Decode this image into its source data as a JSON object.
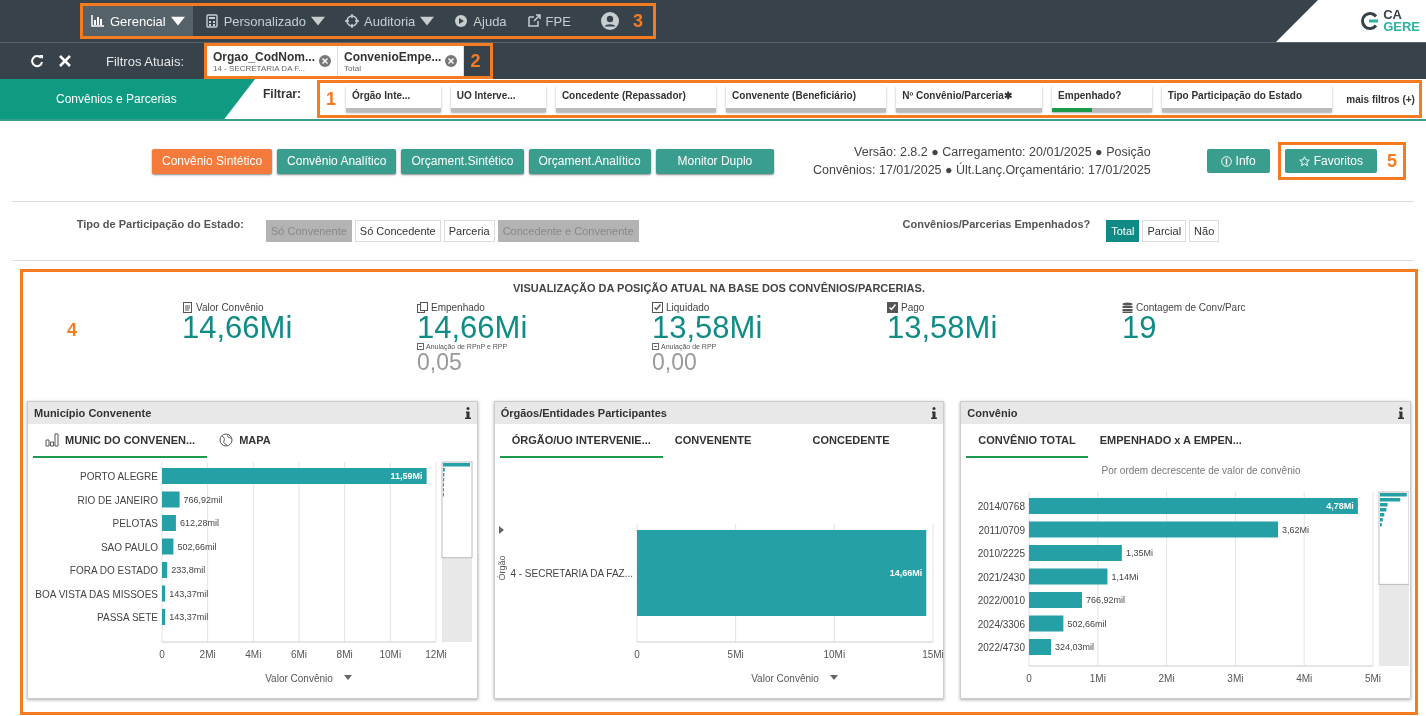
{
  "nav": {
    "callout": "3",
    "items": [
      {
        "label": "Gerencial",
        "kind": "menu",
        "selected": true
      },
      {
        "label": "Personalizado",
        "kind": "menu",
        "selected": false
      },
      {
        "label": "Auditoria",
        "kind": "menu",
        "selected": false
      },
      {
        "label": "Ajuda",
        "kind": "link",
        "selected": false
      },
      {
        "label": "FPE",
        "kind": "link",
        "selected": false
      }
    ],
    "logo": {
      "line1": "CA",
      "line2": "GERE"
    }
  },
  "current_filters": {
    "label": "Filtros Atuais:",
    "callout": "2",
    "chips": [
      {
        "field": "Orgao_CodNom...",
        "value": "14 - SECRETARIA DA F..."
      },
      {
        "field": "ConvenioEmpe...",
        "value": "Total"
      }
    ]
  },
  "filter_bar": {
    "section_tab": "Convênios e Parcerias",
    "label": "Filtrar:",
    "callout": "1",
    "filters": [
      {
        "label": "Órgão Inte...",
        "selected": false
      },
      {
        "label": "UO Interve...",
        "selected": false
      },
      {
        "label": "Concedente (Repassador)",
        "selected": false
      },
      {
        "label": "Convenente (Beneficiário)",
        "selected": false
      },
      {
        "label": "Nº Convênio/Parceria✱",
        "selected": false
      },
      {
        "label": "Empenhado?",
        "selected": true
      },
      {
        "label": "Tipo Participação do Estado",
        "selected": false
      }
    ],
    "more": "mais filtros (+)"
  },
  "views": {
    "buttons": [
      {
        "label": "Convênio Sintético",
        "selected": true
      },
      {
        "label": "Convênio Analítico",
        "selected": false
      },
      {
        "label": "Orçament.Sintético",
        "selected": false
      },
      {
        "label": "Orçament.Analítico",
        "selected": false
      },
      {
        "label": "Monitor Duplo",
        "selected": false
      }
    ],
    "version_text": "Versão: 2.8.2 ● Carregamento: 20/01/2025 ● Posição Convênios: 17/01/2025 ● Últ.Lanç.Orçamentário: 17/01/2025",
    "info_button": "Info",
    "favorites_button": "Favoritos",
    "callout": "5"
  },
  "participation": {
    "label": "Tipo de Participação do Estado:",
    "options": [
      {
        "label": "Só Convenente",
        "disabled": true
      },
      {
        "label": "Só Concedente",
        "disabled": false
      },
      {
        "label": "Parceria",
        "disabled": false
      },
      {
        "label": "Concedente e Convenente",
        "disabled": true
      }
    ]
  },
  "committed": {
    "label": "Convênios/Parcerias Empenhados?",
    "options": [
      {
        "label": "Total",
        "selected": true
      },
      {
        "label": "Parcial",
        "selected": false
      },
      {
        "label": "Não",
        "selected": false
      }
    ]
  },
  "overview": {
    "callout": "4",
    "title": "VISUALIZAÇÃO DA POSIÇÃO ATUAL NA BASE DOS CONVÊNIOS/PARCERIAS.",
    "kpis": [
      {
        "label": "Valor Convênio",
        "value": "14,66Mi"
      },
      {
        "label": "Empenhado",
        "value": "14,66Mi",
        "sub_label": "Anulação de RPnP e RPP",
        "sub_value": "0,05"
      },
      {
        "label": "Liquidado",
        "value": "13,58Mi",
        "sub_label": "Anulação de RPP",
        "sub_value": "0,00"
      },
      {
        "label": "Pago",
        "value": "13,58Mi"
      },
      {
        "label": "Contagem de Conv/Parc",
        "value": "19"
      }
    ],
    "panels": [
      {
        "title": "Município Convenente",
        "tabs": [
          {
            "label": "MUNIC DO CONVENEN...",
            "selected": true
          },
          {
            "label": "MAPA",
            "selected": false
          }
        ],
        "chart_data": {
          "type": "bar",
          "orientation": "horizontal",
          "xlabel": "Valor Convênio",
          "categories": [
            "PORTO ALEGRE",
            "RIO DE JANEIRO",
            "PELOTAS",
            "SAO PAULO",
            "FORA DO ESTADO",
            "BOA VISTA DAS MISSOES",
            "PASSA SETE"
          ],
          "grid": true,
          "series": [
            {
              "color": "#26a0a7",
              "values": [
                11.59,
                0.77,
                0.61,
                0.5,
                0.23,
                0.14,
                0.14
              ]
            }
          ],
          "value_labels": [
            "11,59Mi",
            "766,92mil",
            "612,28mil",
            "502,66mil",
            "233,8mil",
            "143,37mil",
            "143,37mil"
          ],
          "xlim": [
            0,
            12
          ],
          "xticks": [
            {
              "value": 0,
              "label": "0"
            },
            {
              "value": 2,
              "label": "2Mi"
            },
            {
              "value": 4,
              "label": "4Mi"
            },
            {
              "value": 6,
              "label": "6Mi"
            },
            {
              "value": 8,
              "label": "8Mi"
            },
            {
              "value": 10,
              "label": "10Mi"
            },
            {
              "value": 12,
              "label": "12Mi"
            }
          ]
        }
      },
      {
        "title": "Órgãos/Entidades Participantes",
        "tabs": [
          {
            "label": "ÓRGÃO/UO INTERVENIE...",
            "selected": true
          },
          {
            "label": "CONVENENTE",
            "selected": false
          },
          {
            "label": "CONCEDENTE",
            "selected": false
          }
        ],
        "chart_data": {
          "type": "bar",
          "orientation": "horizontal",
          "xlabel": "Valor Convênio",
          "ylabel": "Órgão",
          "categories": [
            "4 - SECRETARIA DA FAZ..."
          ],
          "grid": true,
          "series": [
            {
              "color": "#26a0a7",
              "values": [
                14.66
              ]
            }
          ],
          "value_labels": [
            "14,66Mi"
          ],
          "xlim": [
            0,
            15
          ],
          "xticks": [
            {
              "value": 0,
              "label": "0"
            },
            {
              "value": 5,
              "label": "5Mi"
            },
            {
              "value": 10,
              "label": "10Mi"
            },
            {
              "value": 15,
              "label": "15Mi"
            }
          ]
        }
      },
      {
        "title": "Convênio",
        "tabs": [
          {
            "label": "CONVÊNIO TOTAL",
            "selected": true
          },
          {
            "label": "EMPENHADO x A EMPEN...",
            "selected": false
          }
        ],
        "chart_data": {
          "type": "bar",
          "orientation": "horizontal",
          "title": "Por ordem decrescente de valor de convênio",
          "categories": [
            "2014/0768",
            "2011/0709",
            "2010/2225",
            "2021/2430",
            "2022/0010",
            "2024/3306",
            "2022/4730"
          ],
          "grid": true,
          "series": [
            {
              "color": "#26a0a7",
              "values": [
                4.78,
                3.62,
                1.35,
                1.14,
                0.77,
                0.5,
                0.32
              ]
            }
          ],
          "value_labels": [
            "4,78Mi",
            "3,62Mi",
            "1,35Mi",
            "1,14Mi",
            "766,92mil",
            "502,66mil",
            "324,03mil"
          ],
          "xlim": [
            0,
            5
          ],
          "xticks": [
            {
              "value": 0,
              "label": "0"
            },
            {
              "value": 1,
              "label": "1Mi"
            },
            {
              "value": 2,
              "label": "2Mi"
            },
            {
              "value": 3,
              "label": "3Mi"
            },
            {
              "value": 4,
              "label": "4Mi"
            },
            {
              "value": 5,
              "label": "5Mi"
            }
          ]
        }
      }
    ]
  }
}
